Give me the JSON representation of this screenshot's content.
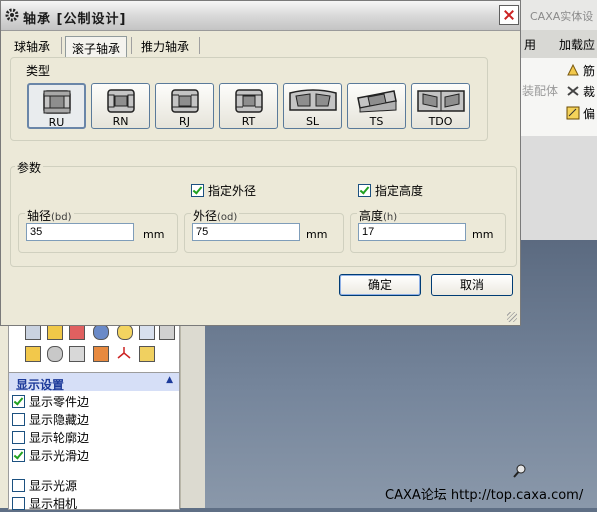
{
  "background_app": {
    "title_fragment": "CAXA实体设",
    "menu": [
      "用",
      "加载应"
    ],
    "ribbon_items": [
      "筋",
      "裁",
      "偏"
    ],
    "ribbon_left_fragment": "装配体",
    "watermark": "CAXA论坛  http://top.caxa.com/",
    "display_panel": {
      "title": "显示设置",
      "options": [
        {
          "label": "显示零件边",
          "checked": true
        },
        {
          "label": "显示隐藏边",
          "checked": false
        },
        {
          "label": "显示轮廓边",
          "checked": false
        },
        {
          "label": "显示光滑边",
          "checked": true
        },
        {
          "label": "显示光源",
          "checked": false
        },
        {
          "label": "显示相机",
          "checked": false
        }
      ]
    }
  },
  "dialog": {
    "title": "轴承 [公制设计]",
    "tabs": [
      {
        "label": "球轴承",
        "active": false
      },
      {
        "label": "滚子轴承",
        "active": true
      },
      {
        "label": "推力轴承",
        "active": false
      }
    ],
    "type_group_label": "类型",
    "types": [
      {
        "label": "RU",
        "selected": true
      },
      {
        "label": "RN",
        "selected": false
      },
      {
        "label": "RJ",
        "selected": false
      },
      {
        "label": "RT",
        "selected": false
      },
      {
        "label": "SL",
        "selected": false
      },
      {
        "label": "TS",
        "selected": false
      },
      {
        "label": "TDO",
        "selected": false
      }
    ],
    "params_label": "参数",
    "specify_outer": {
      "label": "指定外径",
      "checked": true
    },
    "specify_height": {
      "label": "指定高度",
      "checked": true
    },
    "fields": {
      "bore": {
        "label": "轴径",
        "tag": "(bd)",
        "value": "35",
        "unit": "mm"
      },
      "outer": {
        "label": "外径",
        "tag": "(od)",
        "value": "75",
        "unit": "mm"
      },
      "height": {
        "label": "高度",
        "tag": "(h)",
        "value": "17",
        "unit": "mm"
      }
    },
    "ok_label": "确定",
    "cancel_label": "取消"
  }
}
